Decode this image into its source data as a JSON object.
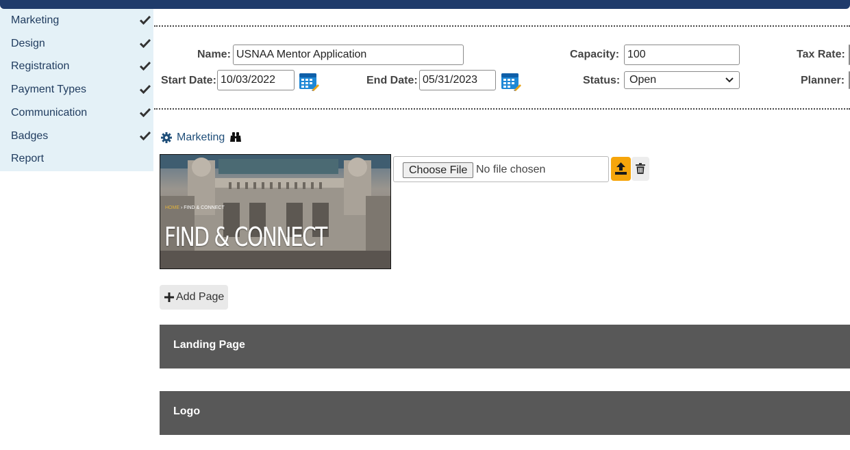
{
  "sidebar": {
    "items": [
      {
        "label": "Marketing",
        "checked": true
      },
      {
        "label": "Design",
        "checked": true
      },
      {
        "label": "Registration",
        "checked": true
      },
      {
        "label": "Payment Types",
        "checked": true
      },
      {
        "label": "Communication",
        "checked": true
      },
      {
        "label": "Badges",
        "checked": true
      },
      {
        "label": "Report",
        "checked": false
      }
    ]
  },
  "form": {
    "name_label": "Name:",
    "name_value": "USNAA Mentor Application",
    "capacity_label": "Capacity:",
    "capacity_value": "100",
    "tax_rate_label": "Tax Rate:",
    "start_date_label": "Start Date:",
    "start_date_value": "10/03/2022",
    "end_date_label": "End Date:",
    "end_date_value": "05/31/2023",
    "status_label": "Status:",
    "status_value": "Open",
    "planner_label": "Planner:"
  },
  "marketing": {
    "title": "Marketing",
    "preview": {
      "breadcrumb_home": "HOME",
      "breadcrumb_rest": "› FIND & CONNECT",
      "headline": "FIND & CONNECT"
    },
    "file_button": "Choose File",
    "file_status": "No file chosen",
    "add_page_label": "Add Page"
  },
  "panels": [
    {
      "title": "Landing Page"
    },
    {
      "title": "Logo"
    }
  ],
  "colors": {
    "topbar": "#1f3b6b",
    "sidebar_bg": "#e4f1f7",
    "upload_accent": "#f6a50b",
    "panel_bg": "#585858"
  }
}
